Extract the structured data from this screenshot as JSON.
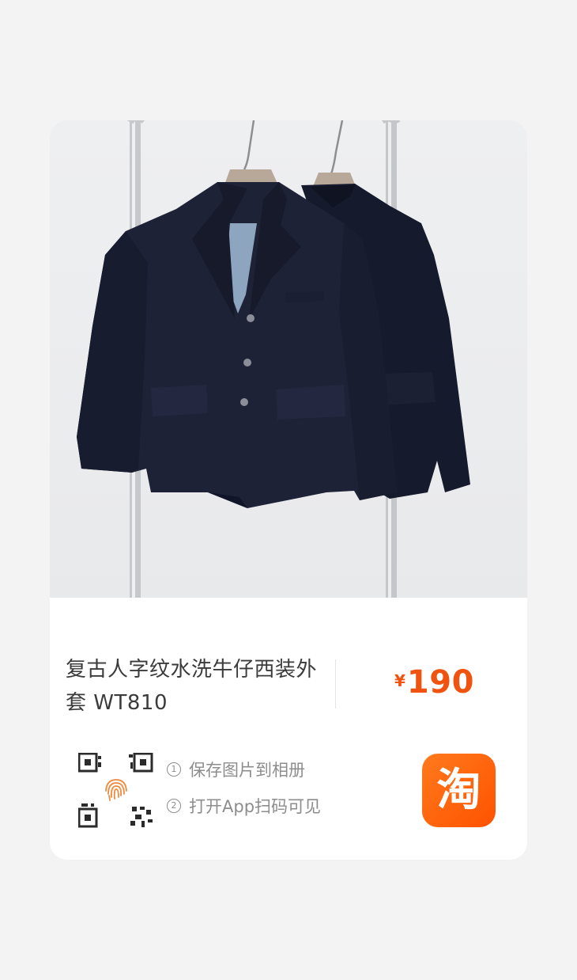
{
  "product": {
    "title": "复古人字纹水洗牛仔西装外套 WT810",
    "currency_symbol": "¥",
    "price": "190"
  },
  "share": {
    "steps": [
      {
        "number": "1",
        "text": "保存图片到相册"
      },
      {
        "number": "2",
        "text": "打开App扫码可见"
      }
    ]
  },
  "brand": {
    "logo_char": "淘",
    "color": "#ff5a00"
  },
  "colors": {
    "price": "#f0520f",
    "background": "#f3f3f3",
    "card": "#ffffff",
    "jacket": "#1d2236"
  }
}
